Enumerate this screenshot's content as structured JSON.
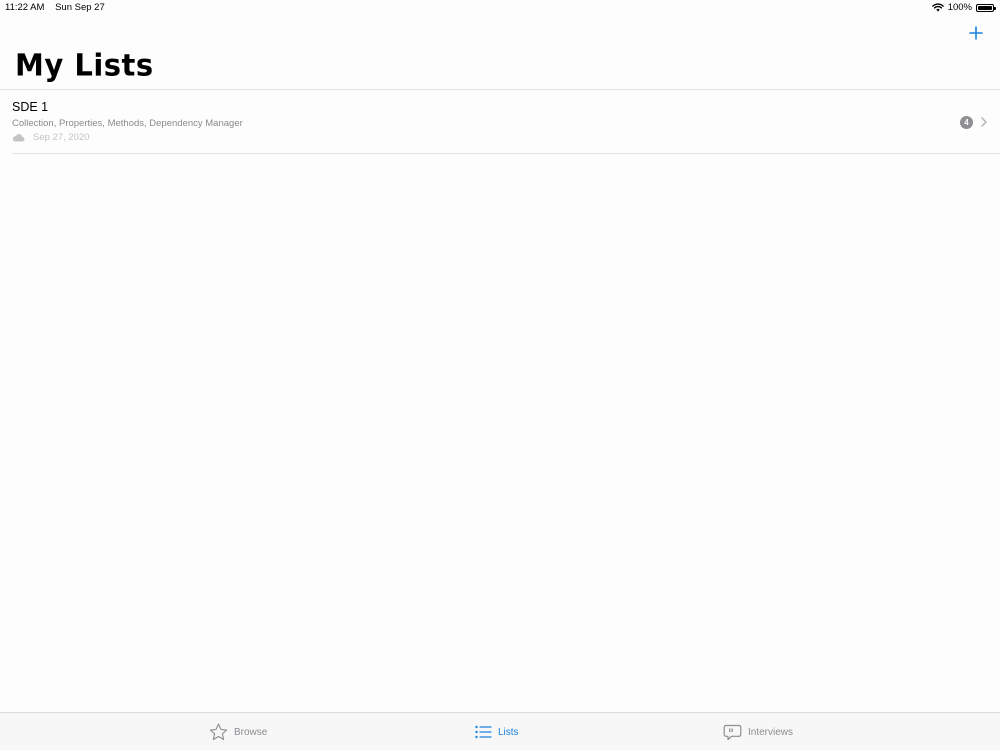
{
  "status": {
    "time": "11:22 AM",
    "date": "Sun Sep 27",
    "battery": "100%",
    "battery_level": 1.0
  },
  "header": {
    "title": "My Lists",
    "add_icon": "plus-icon"
  },
  "lists": [
    {
      "title": "SDE 1",
      "subtitle": "Collection, Properties, Methods, Dependency Manager",
      "date": "Sep 27, 2020",
      "count": "4",
      "sync_icon": "cloud-icon"
    }
  ],
  "tabs": [
    {
      "label": "Browse",
      "icon": "star-icon",
      "selected": false
    },
    {
      "label": "Lists",
      "icon": "list-icon",
      "selected": true
    },
    {
      "label": "Interviews",
      "icon": "speech-bubble-icon",
      "selected": false
    }
  ],
  "colors": {
    "accent": "#1a82e0",
    "inactive": "#8e8e93",
    "secondary_text": "#8a8a8e"
  }
}
